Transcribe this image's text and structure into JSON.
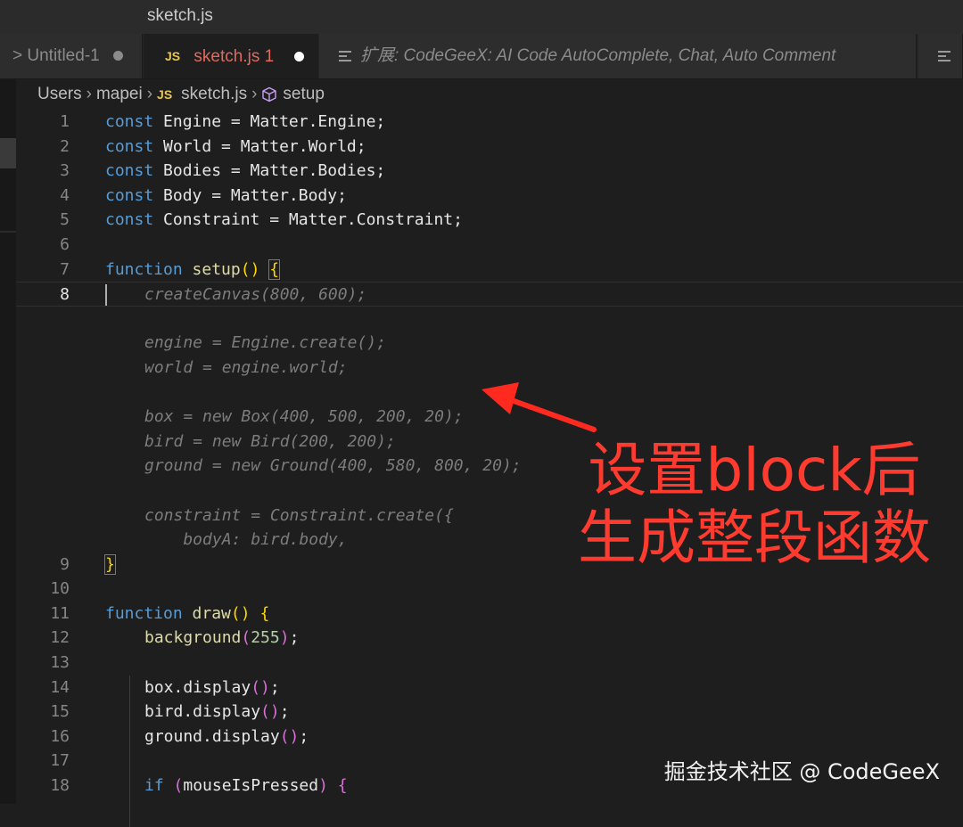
{
  "titlebar": {
    "title": "sketch.js"
  },
  "tabs": {
    "untitled": {
      "label": "Untitled-1",
      "prefix": ">"
    },
    "sketch": {
      "icon": "JS",
      "label": "sketch.js",
      "problems": "1"
    },
    "extension": {
      "label": "扩展: CodeGeeX: AI Code AutoComplete, Chat, Auto Comment"
    }
  },
  "breadcrumb": {
    "users": "Users",
    "user": "mapei",
    "js_icon": "JS",
    "file": "sketch.js",
    "symbol": "setup"
  },
  "code": {
    "l1": {
      "n": "1",
      "kw": "const",
      "rest": " Engine = Matter.Engine;"
    },
    "l2": {
      "n": "2",
      "kw": "const",
      "rest": " World = Matter.World;"
    },
    "l3": {
      "n": "3",
      "kw": "const",
      "rest": " Bodies = Matter.Bodies;"
    },
    "l4": {
      "n": "4",
      "kw": "const",
      "rest": " Body = Matter.Body;"
    },
    "l5": {
      "n": "5",
      "kw": "const",
      "rest": " Constraint = Matter.Constraint;"
    },
    "l6": {
      "n": "6"
    },
    "l7": {
      "n": "7",
      "kw": "function",
      "name": "setup",
      "parens": "()",
      "brace": "{"
    },
    "l8": {
      "n": "8",
      "ghost": "createCanvas(800, 600);"
    },
    "ghost": [
      "",
      "engine = Engine.create();",
      "world = engine.world;",
      "",
      "box = new Box(400, 500, 200, 20);",
      "bird = new Bird(200, 200);",
      "ground = new Ground(400, 580, 800, 20);",
      "",
      "constraint = Constraint.create({",
      "    bodyA: bird.body,"
    ],
    "l9": {
      "n": "9",
      "brace": "}"
    },
    "l10": {
      "n": "10"
    },
    "l11": {
      "n": "11",
      "kw": "function",
      "name": "draw",
      "parens": "()",
      "brace": "{"
    },
    "l12": {
      "n": "12",
      "call": "background",
      "open": "(",
      "arg": "255",
      "close": ")",
      "end": ";"
    },
    "l13": {
      "n": "13"
    },
    "l14": {
      "n": "14",
      "text": "box.display",
      "parens": "()",
      "end": ";"
    },
    "l15": {
      "n": "15",
      "text": "bird.display",
      "parens": "()",
      "end": ";"
    },
    "l16": {
      "n": "16",
      "text": "ground.display",
      "parens": "()",
      "end": ";"
    },
    "l17": {
      "n": "17"
    },
    "l18": {
      "n": "18",
      "kw": "if",
      "open": "(",
      "cond": "mouseIsPressed",
      "close": ")",
      "brace": "{"
    }
  },
  "annotation": {
    "line1": "设置block后",
    "line2": "生成整段函数",
    "color": "#ff3b30"
  },
  "watermark": "掘金技术社区 @ CodeGeeX",
  "colors": {
    "keyword": "#569cd6",
    "function": "#dcdcaa",
    "number": "#b5cea8",
    "ghost_text": "#7c7c7c",
    "modified_tab": "#e06a5f"
  }
}
